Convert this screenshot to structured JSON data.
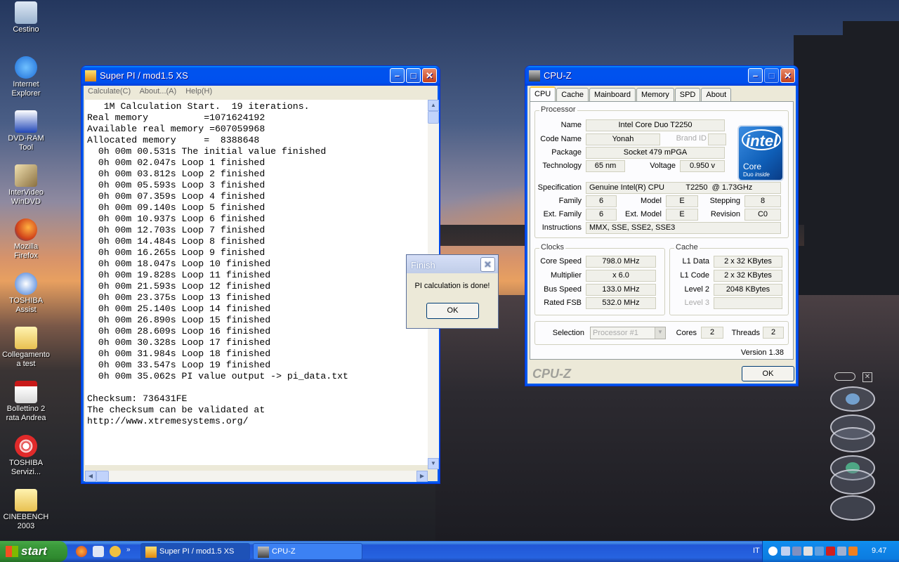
{
  "desktop": {
    "icons": [
      {
        "label": "Cestino"
      },
      {
        "label": "Internet Explorer"
      },
      {
        "label": "DVD-RAM Tool"
      },
      {
        "label": "InterVideo WinDVD"
      },
      {
        "label": "Mozilla Firefox"
      },
      {
        "label": "TOSHIBA Assist"
      },
      {
        "label": "Collegamento a test"
      },
      {
        "label": "Bollettino 2 rata Andrea"
      },
      {
        "label": "TOSHIBA Servizi..."
      },
      {
        "label": "CINEBENCH 2003"
      }
    ]
  },
  "superpi": {
    "title": "Super PI / mod1.5 XS",
    "menu": [
      "Calculate(C)",
      "About...(A)",
      "Help(H)"
    ],
    "lines": [
      "   1M Calculation Start.  19 iterations.",
      "Real memory          =1071624192",
      "Available real memory =607059968",
      "Allocated memory     =  8388648",
      "  0h 00m 00.531s The initial value finished",
      "  0h 00m 02.047s Loop 1 finished",
      "  0h 00m 03.812s Loop 2 finished",
      "  0h 00m 05.593s Loop 3 finished",
      "  0h 00m 07.359s Loop 4 finished",
      "  0h 00m 09.140s Loop 5 finished",
      "  0h 00m 10.937s Loop 6 finished",
      "  0h 00m 12.703s Loop 7 finished",
      "  0h 00m 14.484s Loop 8 finished",
      "  0h 00m 16.265s Loop 9 finished",
      "  0h 00m 18.047s Loop 10 finished",
      "  0h 00m 19.828s Loop 11 finished",
      "  0h 00m 21.593s Loop 12 finished",
      "  0h 00m 23.375s Loop 13 finished",
      "  0h 00m 25.140s Loop 14 finished",
      "  0h 00m 26.890s Loop 15 finished",
      "  0h 00m 28.609s Loop 16 finished",
      "  0h 00m 30.328s Loop 17 finished",
      "  0h 00m 31.984s Loop 18 finished",
      "  0h 00m 33.547s Loop 19 finished",
      "  0h 00m 35.062s PI value output -> pi_data.txt",
      "",
      "Checksum: 736431FE",
      "The checksum can be validated at",
      "http://www.xtremesystems.org/"
    ]
  },
  "finish": {
    "title": "Finish",
    "message": "PI calculation is done!",
    "ok": "OK"
  },
  "cpuz": {
    "title": "CPU-Z",
    "tabs": [
      "CPU",
      "Cache",
      "Mainboard",
      "Memory",
      "SPD",
      "About"
    ],
    "processor": {
      "group": "Processor",
      "name_label": "Name",
      "name": "Intel Core Duo T2250",
      "codename_label": "Code Name",
      "codename": "Yonah",
      "brandid_label": "Brand ID",
      "brandid": "",
      "package_label": "Package",
      "package": "Socket 479 mPGA",
      "technology_label": "Technology",
      "technology": "65 nm",
      "voltage_label": "Voltage",
      "voltage": "0.950 v",
      "spec_label": "Specification",
      "spec": "Genuine Intel(R) CPU          T2250  @ 1.73GHz",
      "family_label": "Family",
      "family": "6",
      "model_label": "Model",
      "model": "E",
      "stepping_label": "Stepping",
      "stepping": "8",
      "extfamily_label": "Ext. Family",
      "extfamily": "6",
      "extmodel_label": "Ext. Model",
      "extmodel": "E",
      "revision_label": "Revision",
      "revision": "C0",
      "instructions_label": "Instructions",
      "instructions": "MMX, SSE, SSE2, SSE3"
    },
    "logo": {
      "brand": "intel",
      "line1": "Core",
      "line2": "Duo",
      "inside": "inside"
    },
    "clocks": {
      "group": "Clocks",
      "corespeed_label": "Core Speed",
      "corespeed": "798.0 MHz",
      "multiplier_label": "Multiplier",
      "multiplier": "x 6.0",
      "busspeed_label": "Bus Speed",
      "busspeed": "133.0 MHz",
      "ratedfsb_label": "Rated FSB",
      "ratedfsb": "532.0 MHz"
    },
    "cache": {
      "group": "Cache",
      "l1data_label": "L1 Data",
      "l1data": "2 x 32 KBytes",
      "l1code_label": "L1 Code",
      "l1code": "2 x 32 KBytes",
      "level2_label": "Level 2",
      "level2": "2048 KBytes",
      "level3_label": "Level 3",
      "level3": ""
    },
    "selection_label": "Selection",
    "selection": "Processor #1",
    "cores_label": "Cores",
    "cores": "2",
    "threads_label": "Threads",
    "threads": "2",
    "version": "Version 1.38",
    "brand_footer": "CPU-Z",
    "ok": "OK"
  },
  "taskbar": {
    "start": "start",
    "tasks": [
      {
        "label": "Super PI / mod1.5 XS"
      },
      {
        "label": "CPU-Z"
      }
    ],
    "language": "IT",
    "clock": "9.47"
  }
}
